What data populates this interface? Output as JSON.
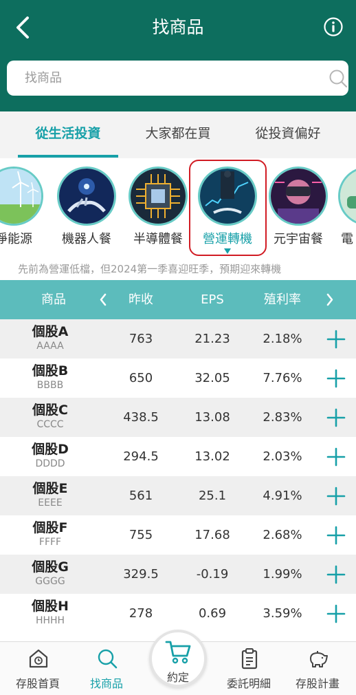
{
  "header": {
    "title": "找商品",
    "back_icon": "chevron-left-icon",
    "info_icon": "info-icon",
    "background_color": "#0d6e5e"
  },
  "search": {
    "placeholder": "找商品",
    "icon": "search-icon"
  },
  "tabs": [
    {
      "label": "從生活投資",
      "active": true
    },
    {
      "label": "大家都在買",
      "active": false
    },
    {
      "label": "從投資偏好",
      "active": false
    }
  ],
  "themes": [
    {
      "label": "淨能源",
      "icon": "wind-turbine-image"
    },
    {
      "label": "機器人餐",
      "icon": "robot-hand-image"
    },
    {
      "label": "半導體餐",
      "icon": "chip-image"
    },
    {
      "label": "營運轉機",
      "icon": "business-chart-image",
      "active": true
    },
    {
      "label": "元宇宙餐",
      "icon": "vr-headset-image"
    },
    {
      "label": "電",
      "icon": "ev-image"
    }
  ],
  "theme_description": "先前為營運低檔，但2024第一季喜迎旺季，預期迎來轉機",
  "table": {
    "headers": {
      "name": "商品",
      "prev_close": "昨收",
      "eps": "EPS",
      "yield": "殖利率"
    },
    "rows": [
      {
        "name": "個股A",
        "code": "AAAA",
        "prev_close": "763",
        "eps": "21.23",
        "yield": "2.18%"
      },
      {
        "name": "個股B",
        "code": "BBBB",
        "prev_close": "650",
        "eps": "32.05",
        "yield": "7.76%"
      },
      {
        "name": "個股C",
        "code": "CCCC",
        "prev_close": "438.5",
        "eps": "13.08",
        "yield": "2.83%"
      },
      {
        "name": "個股D",
        "code": "DDDD",
        "prev_close": "294.5",
        "eps": "13.02",
        "yield": "2.03%"
      },
      {
        "name": "個股E",
        "code": "EEEE",
        "prev_close": "561",
        "eps": "25.1",
        "yield": "4.91%"
      },
      {
        "name": "個股F",
        "code": "FFFF",
        "prev_close": "755",
        "eps": "17.68",
        "yield": "2.68%"
      },
      {
        "name": "個股G",
        "code": "GGGG",
        "prev_close": "329.5",
        "eps": "-0.19",
        "yield": "1.99%"
      },
      {
        "name": "個股H",
        "code": "HHHH",
        "prev_close": "278",
        "eps": "0.69",
        "yield": "3.59%"
      }
    ]
  },
  "bottom_nav": [
    {
      "label": "存股首頁",
      "icon": "home-icon"
    },
    {
      "label": "找商品",
      "icon": "search-icon",
      "active": true
    },
    {
      "label": "約定",
      "icon": "cart-icon"
    },
    {
      "label": "委託明細",
      "icon": "clipboard-icon"
    },
    {
      "label": "存股計畫",
      "icon": "piggy-bank-icon"
    }
  ],
  "colors": {
    "primary": "#0d6e5e",
    "accent": "#17a0a8",
    "table_header": "#5cbcbc",
    "highlight": "#d11b23"
  }
}
